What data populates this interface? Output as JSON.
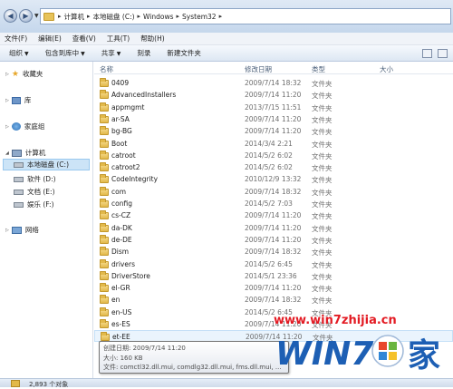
{
  "address": {
    "crumbs": [
      "计算机",
      "本地磁盘 (C:)",
      "Windows",
      "System32"
    ]
  },
  "menubar": {
    "items": [
      "文件(F)",
      "编辑(E)",
      "查看(V)",
      "工具(T)",
      "帮助(H)"
    ]
  },
  "toolbar": {
    "organize": "组织",
    "include_library": "包含到库中",
    "share": "共享",
    "burn": "刻录",
    "new_folder": "新建文件夹"
  },
  "navpane": {
    "favorites": "收藏夹",
    "libraries": "库",
    "homegroup": "家庭组",
    "computer": "计算机",
    "drive_c": "本地磁盘 (C:)",
    "drive_d": "软件 (D:)",
    "drive_e": "文档 (E:)",
    "drive_f": "娱乐 (F:)",
    "network": "网络"
  },
  "columns": {
    "name": "名称",
    "modified": "修改日期",
    "type": "类型",
    "size": "大小"
  },
  "files": [
    {
      "name": "0409",
      "date": "2009/7/14 18:32",
      "type": "文件夹"
    },
    {
      "name": "AdvancedInstallers",
      "date": "2009/7/14 11:20",
      "type": "文件夹"
    },
    {
      "name": "appmgmt",
      "date": "2013/7/15 11:51",
      "type": "文件夹"
    },
    {
      "name": "ar-SA",
      "date": "2009/7/14 11:20",
      "type": "文件夹"
    },
    {
      "name": "bg-BG",
      "date": "2009/7/14 11:20",
      "type": "文件夹"
    },
    {
      "name": "Boot",
      "date": "2014/3/4 2:21",
      "type": "文件夹"
    },
    {
      "name": "catroot",
      "date": "2014/5/2 6:02",
      "type": "文件夹"
    },
    {
      "name": "catroot2",
      "date": "2014/5/2 6:02",
      "type": "文件夹"
    },
    {
      "name": "CodeIntegrity",
      "date": "2010/12/9 13:32",
      "type": "文件夹"
    },
    {
      "name": "com",
      "date": "2009/7/14 18:32",
      "type": "文件夹"
    },
    {
      "name": "config",
      "date": "2014/5/2 7:03",
      "type": "文件夹"
    },
    {
      "name": "cs-CZ",
      "date": "2009/7/14 11:20",
      "type": "文件夹"
    },
    {
      "name": "da-DK",
      "date": "2009/7/14 11:20",
      "type": "文件夹"
    },
    {
      "name": "de-DE",
      "date": "2009/7/14 11:20",
      "type": "文件夹"
    },
    {
      "name": "Dism",
      "date": "2009/7/14 18:32",
      "type": "文件夹"
    },
    {
      "name": "drivers",
      "date": "2014/5/2 6:45",
      "type": "文件夹"
    },
    {
      "name": "DriverStore",
      "date": "2014/5/1 23:36",
      "type": "文件夹"
    },
    {
      "name": "el-GR",
      "date": "2009/7/14 11:20",
      "type": "文件夹"
    },
    {
      "name": "en",
      "date": "2009/7/14 18:32",
      "type": "文件夹"
    },
    {
      "name": "en-US",
      "date": "2014/5/2 6:45",
      "type": "文件夹"
    },
    {
      "name": "es-ES",
      "date": "2009/7/14 11:20",
      "type": "文件夹"
    },
    {
      "name": "et-EE",
      "date": "2009/7/14 11:20",
      "type": "文件夹"
    }
  ],
  "tooltip": {
    "created": "创建日期: 2009/7/14 11:20",
    "size": "大小: 160 KB",
    "files": "文件: comctl32.dll.mui, comdlg32.dll.mui, fms.dll.mui, ..."
  },
  "status": {
    "count": "2,893 个对象"
  },
  "watermark": {
    "url": "www.win7zhijia.cn",
    "brand_prefix": "WIN7",
    "brand_suffix": "家"
  },
  "colors": {
    "folder": "#e2b94a",
    "selection": "#cce4f7",
    "watermark_red": "#e31b23",
    "watermark_blue": "#1d5fb4"
  }
}
